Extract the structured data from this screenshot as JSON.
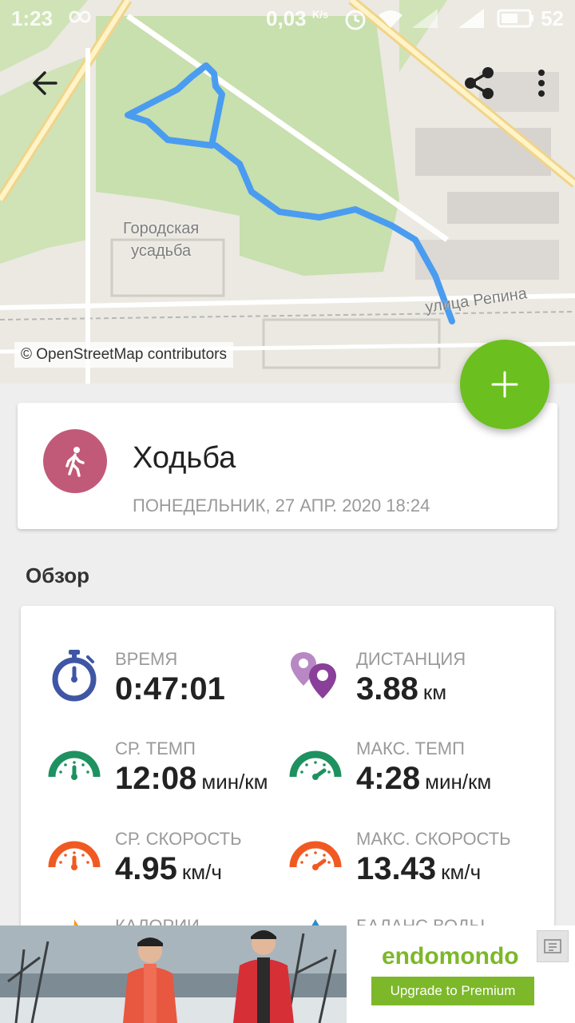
{
  "status_bar": {
    "time": "1:23",
    "speed": "0,03",
    "speed_unit": "K/s",
    "battery": "52"
  },
  "map": {
    "place_label_line1": "Городская",
    "place_label_line2": "усадьба",
    "street_label": "улица Репина",
    "attribution": "© OpenStreetMap contributors"
  },
  "toolbar": {
    "back_icon": "arrow-left-icon",
    "share_icon": "share-icon",
    "more_icon": "more-vert-icon"
  },
  "fab": {
    "icon": "plus-icon",
    "color": "#6bbf1e"
  },
  "activity": {
    "title": "Ходьба",
    "date": "ПОНЕДЕЛЬНИК, 27 АПР. 2020 18:24",
    "icon": "walking-person-icon",
    "color": "#c15a78"
  },
  "overview": {
    "title": "Обзор",
    "stats": [
      {
        "label": "ВРЕМЯ",
        "value": "0:47:01",
        "unit": "",
        "icon": "stopwatch-icon",
        "color": "#3f56a5"
      },
      {
        "label": "ДИСТАНЦИЯ",
        "value": "3.88",
        "unit": "км",
        "icon": "map-pins-icon",
        "color": "#8a3f9a"
      },
      {
        "label": "СР. ТЕМП",
        "value": "12:08",
        "unit": "мин/км",
        "icon": "speedometer-icon",
        "color": "#1e9160"
      },
      {
        "label": "МАКС. ТЕМП",
        "value": "4:28",
        "unit": "мин/км",
        "icon": "speedometer-icon",
        "color": "#1e9160"
      },
      {
        "label": "СР. СКОРОСТЬ",
        "value": "4.95",
        "unit": "км/ч",
        "icon": "speedometer-icon",
        "color": "#f05a22"
      },
      {
        "label": "МАКС. СКОРОСТЬ",
        "value": "13.43",
        "unit": "км/ч",
        "icon": "speedometer-icon",
        "color": "#f05a22"
      },
      {
        "label": "КАЛОРИИ",
        "value": "",
        "unit": "",
        "icon": "flame-icon",
        "color": "#f39c12"
      },
      {
        "label": "БАЛАНС ВОДЫ",
        "value": "",
        "unit": "",
        "icon": "water-drop-icon",
        "color": "#2a8ec9"
      }
    ]
  },
  "ad": {
    "brand": "endomondo",
    "button": "Upgrade to Premium",
    "close_icon": "ad-close-icon",
    "brand_color": "#7cb829"
  }
}
